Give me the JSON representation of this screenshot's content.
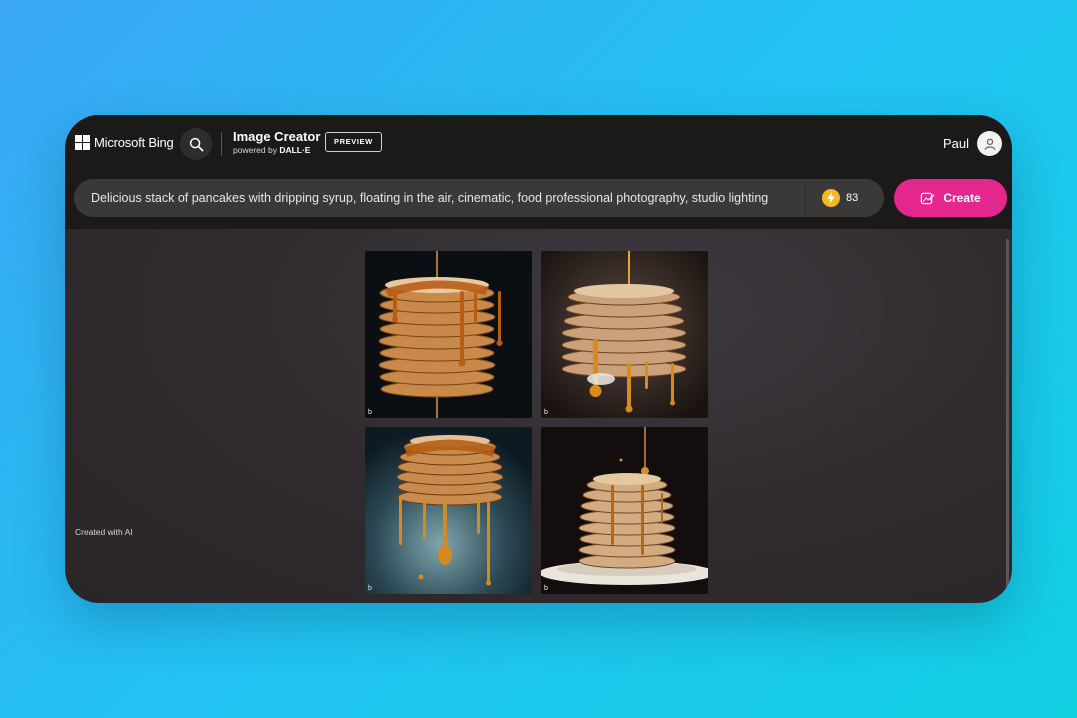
{
  "header": {
    "logo_text": "Microsoft Bing",
    "brand_title": "Image Creator",
    "brand_sub_prefix": "powered by ",
    "brand_sub_model": "DALL·E",
    "preview_badge": "PREVIEW",
    "user_name": "Paul"
  },
  "prompt": {
    "value": "Delicious stack of pancakes with dripping syrup, floating in the air, cinematic, food professional photography, studio lighting"
  },
  "boosts": {
    "count": "83"
  },
  "create_button": {
    "label": "Create"
  },
  "images": [
    {
      "name": "pancake-image-1",
      "mark": "b"
    },
    {
      "name": "pancake-image-2",
      "mark": "b"
    },
    {
      "name": "pancake-image-3",
      "mark": "b"
    },
    {
      "name": "pancake-image-4",
      "mark": "b"
    }
  ],
  "footer": {
    "created_with_ai": "Created with AI"
  },
  "colors": {
    "accent": "#e3278d",
    "header_bg": "#1b1a19",
    "boost_coin": "#f5b921"
  }
}
